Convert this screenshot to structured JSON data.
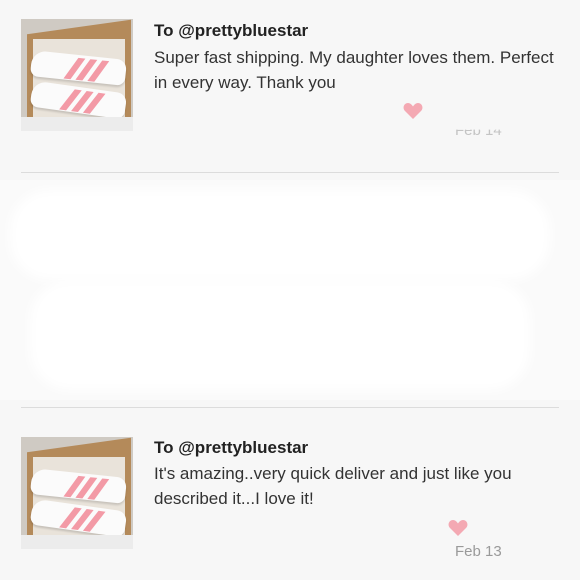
{
  "reviews": [
    {
      "handle": "To @prettybluestar",
      "text": "Super fast shipping. My daughter loves them. Perfect in every way. Thank you",
      "date": "Feb 14",
      "image": "sneakers-in-box"
    },
    {
      "handle": "To @prettybluestar",
      "text": "It's amazing..very quick deliver and just like you described it...I love it!",
      "date": "Feb 13",
      "image": "sneakers-in-box"
    }
  ],
  "icons": {
    "like": "heart-icon"
  },
  "colors": {
    "heart": "#f4a9b3",
    "stripe": "#f39aa6",
    "date": "#9a9a9a",
    "divider": "#dcdcdc"
  }
}
